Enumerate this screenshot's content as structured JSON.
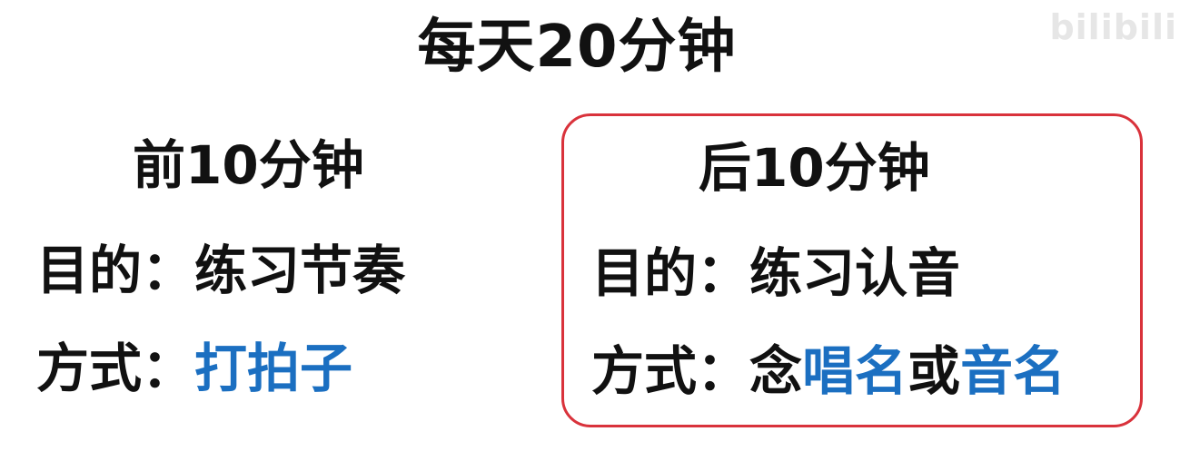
{
  "title": "每天20分钟",
  "watermark": "bilibili",
  "left": {
    "heading": "前10分钟",
    "purpose_label": "目的：",
    "purpose_value": "练习节奏",
    "method_label": "方式：",
    "method_value": "打拍子"
  },
  "right": {
    "heading": "后10分钟",
    "purpose_label": "目的：",
    "purpose_value": "练习认音",
    "method_label": "方式：",
    "method_prefix": "念",
    "method_value_1": "唱名",
    "method_joiner": "或",
    "method_value_2": "音名"
  },
  "colors": {
    "highlight_blue": "#1b6fc1",
    "border_red": "#d9323b",
    "text": "#111111"
  }
}
